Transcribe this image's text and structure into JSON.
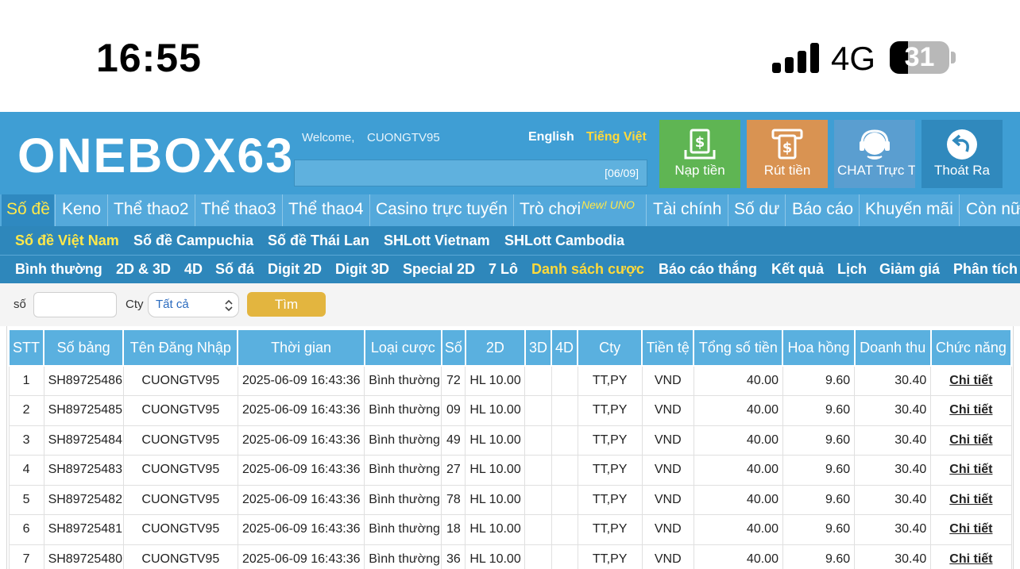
{
  "status_bar": {
    "time": "16:55",
    "network": "4G",
    "battery": "31",
    "battery_level": 0.31
  },
  "header": {
    "logo": "ONEBOX63",
    "welcome_label": "Welcome,",
    "username": "CUONGTV95",
    "lang_english": "English",
    "lang_vietnamese": "Tiếng Việt",
    "marquee_text": "[06/09]",
    "buttons": {
      "deposit": "Nạp tiền",
      "withdraw": "Rút tiền",
      "chat": "CHAT Trực Tuyến",
      "logout": "Thoát Ra"
    }
  },
  "main_nav": {
    "items": [
      "Số đề",
      "Keno",
      "Thể thao2",
      "Thể thao3",
      "Thể thao4",
      "Casino trực tuyến",
      "Trò chơi",
      "Tài chính",
      "Số dư",
      "Báo cáo",
      "Khuyến mãi",
      "Còn nữa"
    ],
    "new_badge": "New! UNO"
  },
  "sub_nav": {
    "items": [
      "Số đề Việt Nam",
      "Số đề Campuchia",
      "Số đề Thái Lan",
      "SHLott Vietnam",
      "SHLott Cambodia"
    ]
  },
  "third_nav": {
    "items": [
      "Bình thường",
      "2D & 3D",
      "4D",
      "Số đá",
      "Digit 2D",
      "Digit 3D",
      "Special 2D",
      "7 Lô",
      "Danh sách cược",
      "Báo cáo thắng",
      "Kết quả",
      "Lịch",
      "Giảm giá",
      "Phân tích"
    ]
  },
  "filter": {
    "so_label": "số",
    "so_value": "",
    "cty_label": "Cty",
    "cty_selected": "Tất cả",
    "search_button": "Tìm"
  },
  "table": {
    "headers": [
      "STT",
      "Số bảng",
      "Tên Đăng Nhập",
      "Thời gian",
      "Loại cược",
      "Số",
      "2D",
      "3D",
      "4D",
      "Cty",
      "Tiền tệ",
      "Tổng số tiền",
      "Hoa hồng",
      "Doanh thu",
      "Chức năng"
    ],
    "rows": [
      [
        "1",
        "SH89725486",
        "CUONGTV95",
        "2025-06-09 16:43:36",
        "Bình thường",
        "72",
        "HL 10.00",
        "",
        "",
        "TT,PY",
        "VND",
        "40.00",
        "9.60",
        "30.40",
        "Chi tiết"
      ],
      [
        "2",
        "SH89725485",
        "CUONGTV95",
        "2025-06-09 16:43:36",
        "Bình thường",
        "09",
        "HL 10.00",
        "",
        "",
        "TT,PY",
        "VND",
        "40.00",
        "9.60",
        "30.40",
        "Chi tiết"
      ],
      [
        "3",
        "SH89725484",
        "CUONGTV95",
        "2025-06-09 16:43:36",
        "Bình thường",
        "49",
        "HL 10.00",
        "",
        "",
        "TT,PY",
        "VND",
        "40.00",
        "9.60",
        "30.40",
        "Chi tiết"
      ],
      [
        "4",
        "SH89725483",
        "CUONGTV95",
        "2025-06-09 16:43:36",
        "Bình thường",
        "27",
        "HL 10.00",
        "",
        "",
        "TT,PY",
        "VND",
        "40.00",
        "9.60",
        "30.40",
        "Chi tiết"
      ],
      [
        "5",
        "SH89725482",
        "CUONGTV95",
        "2025-06-09 16:43:36",
        "Bình thường",
        "78",
        "HL 10.00",
        "",
        "",
        "TT,PY",
        "VND",
        "40.00",
        "9.60",
        "30.40",
        "Chi tiết"
      ],
      [
        "6",
        "SH89725481",
        "CUONGTV95",
        "2025-06-09 16:43:36",
        "Bình thường",
        "18",
        "HL 10.00",
        "",
        "",
        "TT,PY",
        "VND",
        "40.00",
        "9.60",
        "30.40",
        "Chi tiết"
      ],
      [
        "7",
        "SH89725480",
        "CUONGTV95",
        "2025-06-09 16:43:36",
        "Bình thường",
        "36",
        "HL 10.00",
        "",
        "",
        "TT,PY",
        "VND",
        "40.00",
        "9.60",
        "30.40",
        "Chi tiết"
      ]
    ]
  },
  "colors": {
    "header_bg": "#3f9ed4",
    "nav_bg": "#54a9db",
    "subnav_bg": "#2e87bb",
    "accent_yellow": "#ffe84a",
    "table_header_bg": "#5ab0df",
    "search_button_bg": "#e3b53f"
  }
}
